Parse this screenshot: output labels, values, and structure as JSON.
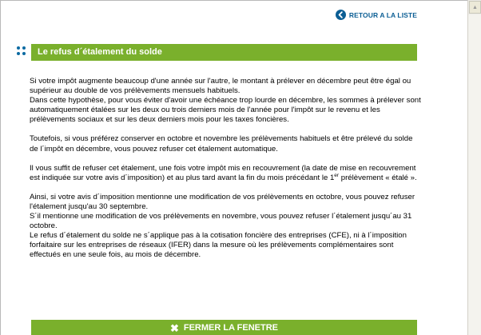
{
  "header": {
    "back_label": "RETOUR A LA LISTE",
    "back_icon": "back-arrow-icon",
    "accent": "#0b5e94"
  },
  "section": {
    "title": "Le refus d´étalement du solde",
    "bullet_icon": "four-dots-icon",
    "bar_color": "#7ab02c"
  },
  "content": {
    "p1_line1": "Si votre impôt augmente beaucoup d'une année sur l'autre, le montant à prélever en décembre peut être égal ou supérieur au double de vos prélèvements mensuels habituels.",
    "p1_line2": "Dans cette hypothèse, pour vous éviter d'avoir une échéance trop lourde en décembre, les sommes à prélever sont automatiquement étalées sur les deux ou trois derniers mois de l'année pour l'impôt sur le revenu et les prélèvements sociaux et sur les deux derniers mois pour les taxes foncières.",
    "p2": "Toutefois, si vous préférez conserver en octobre et novembre les prélèvements habituels et être prélevé du solde de l´impôt en décembre, vous pouvez refuser cet étalement automatique.",
    "p3_start": "Il vous suffit de refuser cet étalement, une fois votre impôt mis en recouvrement (la date de mise en recouvrement est indiquée sur votre avis d´imposition) et au plus tard avant la fin du mois précédant le 1",
    "p3_sup": "er",
    "p3_end": " prélèvement « étalé ».",
    "p4_line1": "Ainsi, si votre avis d´imposition mentionne une modification de vos prélèvements en octobre, vous pouvez refuser l'étalement jusqu'au 30 septembre.",
    "p4_line2": "S´il mentionne une modification de vos prélèvements en novembre, vous pouvez refuser l´étalement jusqu´au 31 octobre.",
    "p4_line3": "Le refus d´étalement du solde ne s´applique pas à la cotisation foncière des entreprises (CFE), ni à l´imposition forfaitaire sur les entreprises de réseaux (IFER) dans la mesure où les prélèvements complémentaires sont effectués en une seule fois, au mois de décembre."
  },
  "footer": {
    "close_label": "FERMER LA FENETRE",
    "close_icon": "close-x-icon"
  }
}
